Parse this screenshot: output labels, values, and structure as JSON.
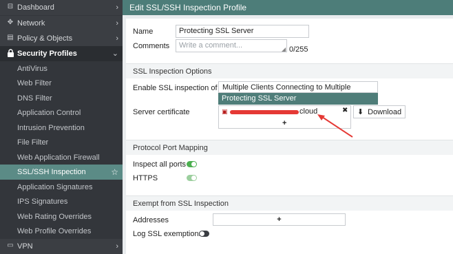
{
  "sidebar": {
    "items": [
      {
        "label": "Dashboard",
        "icon": "dashboard-icon",
        "type": "section"
      },
      {
        "label": "Network",
        "icon": "network-icon",
        "type": "section"
      },
      {
        "label": "Policy & Objects",
        "icon": "policy-icon",
        "type": "section"
      },
      {
        "label": "Security Profiles",
        "icon": "lock-icon",
        "type": "section-open"
      },
      {
        "label": "AntiVirus",
        "type": "sub"
      },
      {
        "label": "Web Filter",
        "type": "sub"
      },
      {
        "label": "DNS Filter",
        "type": "sub"
      },
      {
        "label": "Application Control",
        "type": "sub"
      },
      {
        "label": "Intrusion Prevention",
        "type": "sub"
      },
      {
        "label": "File Filter",
        "type": "sub"
      },
      {
        "label": "Web Application Firewall",
        "type": "sub"
      },
      {
        "label": "SSL/SSH Inspection",
        "type": "active"
      },
      {
        "label": "Application Signatures",
        "type": "sub"
      },
      {
        "label": "IPS Signatures",
        "type": "sub"
      },
      {
        "label": "Web Rating Overrides",
        "type": "sub"
      },
      {
        "label": "Web Profile Overrides",
        "type": "sub"
      },
      {
        "label": "VPN",
        "icon": "vpn-icon",
        "type": "section"
      }
    ]
  },
  "header": {
    "title": "Edit SSL/SSH Inspection Profile"
  },
  "form": {
    "name_label": "Name",
    "name_value": "Protecting SSL Server",
    "comments_label": "Comments",
    "comments_placeholder": "Write a comment...",
    "comments_counter": "0/255",
    "ssl_options_header": "SSL Inspection Options",
    "enable_label": "Enable SSL inspection of",
    "option_multi": "Multiple Clients Connecting to Multiple Servers",
    "option_protect": "Protecting SSL Server",
    "server_cert_label": "Server certificate",
    "cert_value_suffix": "cloud",
    "add_symbol": "+",
    "remove_symbol": "✖",
    "download_label": "Download",
    "port_mapping_header": "Protocol Port Mapping",
    "inspect_all_label": "Inspect all ports",
    "https_label": "HTTPS",
    "exempt_header": "Exempt from SSL Inspection",
    "addresses_label": "Addresses",
    "log_ssl_label": "Log SSL exemptions"
  },
  "colors": {
    "accent": "#4d7d79",
    "active": "#5b8b86",
    "sidebar_bg": "#33363b",
    "selected_option": "#4f7d79",
    "toggle_on": "#4caf50",
    "annotation": "#e53935"
  }
}
